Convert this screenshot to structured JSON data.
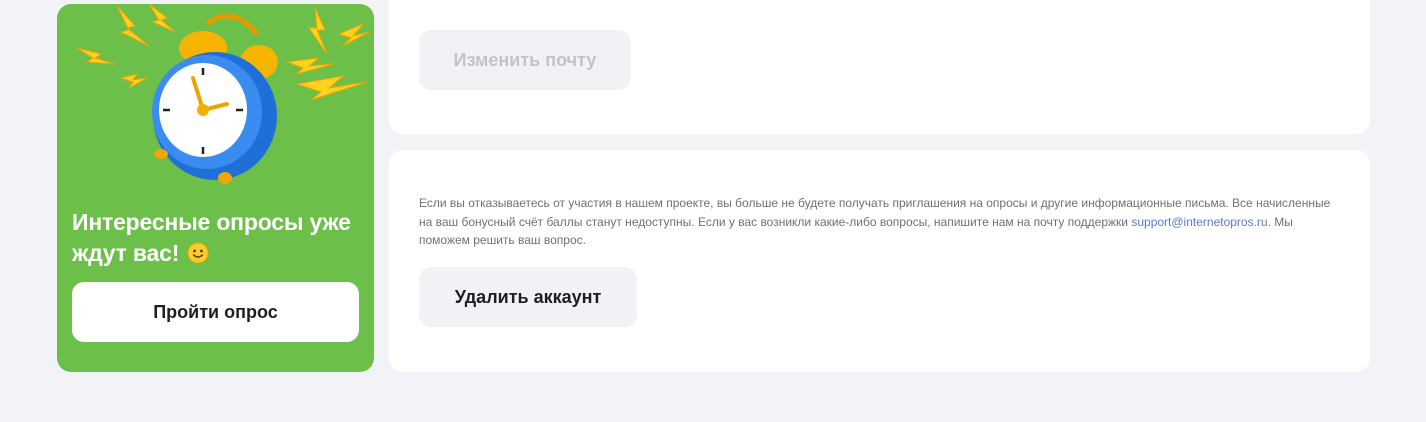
{
  "promo": {
    "title": "Интересные опросы уже ждут вас!",
    "button_label": "Пройти опрос",
    "illustration_icon": "alarm-clock-icon",
    "emoji_icon": "smile-emoji-icon",
    "background_color": "#6cc04a"
  },
  "email_section": {
    "change_email_label": "Изменить почту"
  },
  "delete_section": {
    "notice_text_before_link": "Если вы отказываетесь от участия в нашем проекте, вы больше не будете получать приглашения на опросы и другие информационные письма. Все начисленные на ваш бонусный счёт баллы станут недоступны. Если у вас возникли какие-либо вопросы, напишите нам на почту поддержки ",
    "support_email": "support@internetopros.ru",
    "notice_text_after_link": ". Мы поможем решить ваш вопрос.",
    "delete_button_label": "Удалить аккаунт"
  },
  "colors": {
    "page_background": "#f2f3f7",
    "card_background": "#ffffff",
    "link": "#5b78d6"
  }
}
